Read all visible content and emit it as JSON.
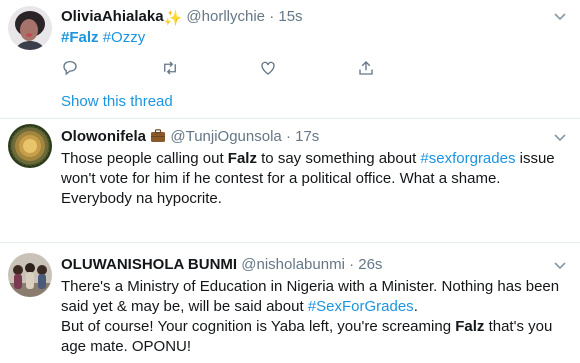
{
  "tweets": [
    {
      "name": "OliviaAhialaka",
      "name_emoji": "✨",
      "handle": "@horllychie",
      "dot": "·",
      "time": "15s",
      "body": [
        {
          "text": "#Falz",
          "style": "tag-bold"
        },
        {
          "text": " ",
          "style": "plain"
        },
        {
          "text": "#Ozzy",
          "style": "tag"
        }
      ],
      "show_thread": "Show this thread"
    },
    {
      "name": "Olowonifela",
      "name_emoji": "💼",
      "handle": "@TunjiOgunsola",
      "dot": "·",
      "time": "17s",
      "body": [
        {
          "text": "Those people calling out ",
          "style": "plain"
        },
        {
          "text": "Falz",
          "style": "bold"
        },
        {
          "text": " to say something about ",
          "style": "plain"
        },
        {
          "text": "#sexforgrades",
          "style": "tag"
        },
        {
          "text": " issue won't vote for him if he contest for a political office. What a shame. Everybody na hypocrite.",
          "style": "plain"
        }
      ]
    },
    {
      "name": "OLUWANISHOLA BUNMI",
      "handle": "@nisholabunmi",
      "dot": "·",
      "time": "26s",
      "body": [
        {
          "text": "There's a Ministry of Education in Nigeria with a Minister. Nothing has been said yet & may be, will be said about ",
          "style": "plain"
        },
        {
          "text": "#SexForGrades",
          "style": "tag"
        },
        {
          "text": ".",
          "style": "plain"
        },
        {
          "text": "\n",
          "style": "br"
        },
        {
          "text": "But of course! Your cognition is Yaba left, you're screaming ",
          "style": "plain"
        },
        {
          "text": "Falz",
          "style": "bold"
        },
        {
          "text": " that's you age mate. OPONU!",
          "style": "plain"
        }
      ]
    }
  ],
  "more_icon": "chevron-down-icon",
  "action_icons": [
    "reply-icon",
    "retweet-icon",
    "like-icon",
    "share-icon"
  ],
  "colors": {
    "link": "#1b95e0",
    "icon": "#657786",
    "divider": "#e6ecf0",
    "name": "#14171a"
  }
}
